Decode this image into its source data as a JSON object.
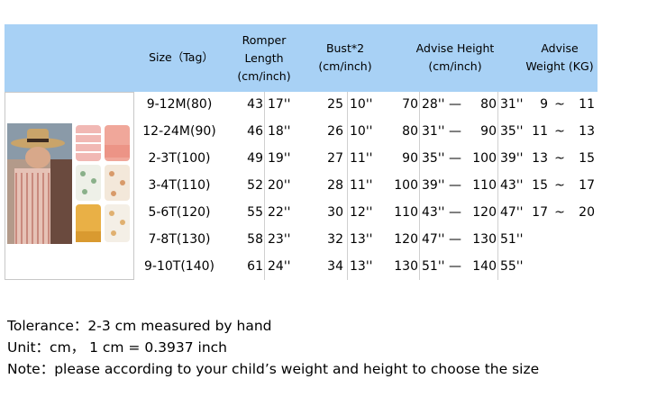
{
  "header": {
    "size": "Size（Tag）",
    "romper": [
      "Romper",
      "Length",
      "(cm/inch)"
    ],
    "bust": [
      "Bust*2",
      "(cm/inch)"
    ],
    "height": [
      "Advise Height",
      "(cm/inch)"
    ],
    "weight": [
      "Advise",
      "Weight (KG)"
    ]
  },
  "rows": [
    {
      "size": "9-12M(80)",
      "len_cm": "43",
      "len_in": "17''",
      "bust_cm": "25",
      "bust_in": "10''",
      "h_from_cm": "70",
      "h_from_in": "28''",
      "dash": "—",
      "h_to_cm": "80",
      "h_to_in": "31''",
      "w_from": "9",
      "tilde": "~",
      "w_to": "11"
    },
    {
      "size": "12-24M(90)",
      "len_cm": "46",
      "len_in": "18''",
      "bust_cm": "26",
      "bust_in": "10''",
      "h_from_cm": "80",
      "h_from_in": "31''",
      "dash": "—",
      "h_to_cm": "90",
      "h_to_in": "35''",
      "w_from": "11",
      "tilde": "~",
      "w_to": "13"
    },
    {
      "size": "2-3T(100)",
      "len_cm": "49",
      "len_in": "19''",
      "bust_cm": "27",
      "bust_in": "11''",
      "h_from_cm": "90",
      "h_from_in": "35''",
      "dash": "—",
      "h_to_cm": "100",
      "h_to_in": "39''",
      "w_from": "13",
      "tilde": "~",
      "w_to": "15"
    },
    {
      "size": "3-4T(110)",
      "len_cm": "52",
      "len_in": "20''",
      "bust_cm": "28",
      "bust_in": "11''",
      "h_from_cm": "100",
      "h_from_in": "39''",
      "dash": "—",
      "h_to_cm": "110",
      "h_to_in": "43''",
      "w_from": "15",
      "tilde": "~",
      "w_to": "17"
    },
    {
      "size": "5-6T(120)",
      "len_cm": "55",
      "len_in": "22''",
      "bust_cm": "30",
      "bust_in": "12''",
      "h_from_cm": "110",
      "h_from_in": "43''",
      "dash": "—",
      "h_to_cm": "120",
      "h_to_in": "47''",
      "w_from": "17",
      "tilde": "~",
      "w_to": "20"
    },
    {
      "size": "7-8T(130)",
      "len_cm": "58",
      "len_in": "23''",
      "bust_cm": "32",
      "bust_in": "13''",
      "h_from_cm": "120",
      "h_from_in": "47''",
      "dash": "—",
      "h_to_cm": "130",
      "h_to_in": "51''",
      "w_from": "",
      "tilde": "",
      "w_to": ""
    },
    {
      "size": "9-10T(140)",
      "len_cm": "61",
      "len_in": "24''",
      "bust_cm": "34",
      "bust_in": "13''",
      "h_from_cm": "130",
      "h_from_in": "51''",
      "dash": "—",
      "h_to_cm": "140",
      "h_to_in": "55''",
      "w_from": "",
      "tilde": "",
      "w_to": ""
    }
  ],
  "notes": {
    "tolerance": "Tolerance：2-3 cm measured by hand",
    "unit": "Unit：cm，  1 cm = 0.3937 inch",
    "note": "Note：please according to your child’s weight and height to choose the size"
  }
}
